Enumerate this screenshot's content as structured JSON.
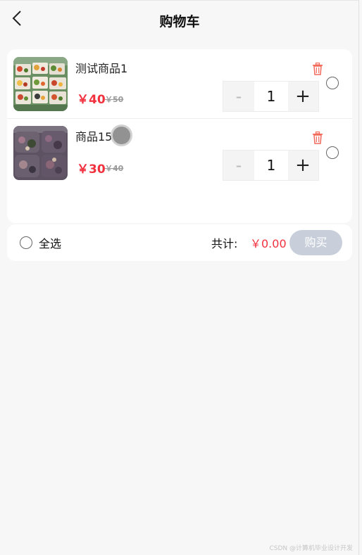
{
  "header": {
    "title": "购物车"
  },
  "items": [
    {
      "name": "测试商品1",
      "price": "￥40",
      "old_price": "￥50",
      "quantity": "1",
      "minus": "-",
      "plus": "+"
    },
    {
      "name": "商品15",
      "price": "￥30",
      "old_price": "￥40",
      "quantity": "1",
      "minus": "-",
      "plus": "+"
    }
  ],
  "footer": {
    "select_all": "全选",
    "total_label": "共计:",
    "total_value": "￥0.00",
    "buy": "购买"
  },
  "watermark": "CSDN @计算机毕业设计开发",
  "icons": {
    "back": "chevron-left-icon",
    "delete": "trash-icon"
  },
  "colors": {
    "price": "#f2313f",
    "delete": "#f26a5b",
    "buy_disabled": "#c8cfdb"
  }
}
